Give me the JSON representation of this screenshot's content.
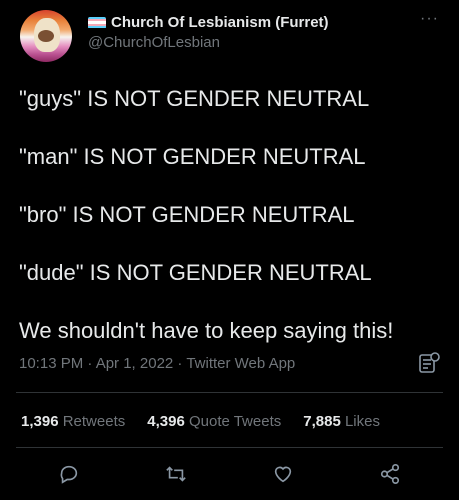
{
  "author": {
    "display_name": "Church Of Lesbianism (Furret)",
    "handle": "@ChurchOfLesbian",
    "flag_colors": [
      "#5bcefa",
      "#f5a9b8",
      "#ffffff",
      "#f5a9b8",
      "#5bcefa"
    ]
  },
  "tweet": {
    "lines": [
      "\"guys\" IS NOT GENDER NEUTRAL",
      "\"man\" IS NOT GENDER NEUTRAL",
      "\"bro\" IS NOT GENDER NEUTRAL",
      "\"dude\" IS NOT GENDER NEUTRAL",
      "We shouldn't have to keep saying this!"
    ],
    "meta": "10:13 PM · Apr 1, 2022 · Twitter Web App"
  },
  "stats": {
    "retweets_count": "1,396",
    "retweets_label": "Retweets",
    "quotes_count": "4,396",
    "quotes_label": "Quote Tweets",
    "likes_count": "7,885",
    "likes_label": "Likes"
  },
  "more_glyph": "···",
  "colors": {
    "background": "#000000",
    "text": "#e7e9ea",
    "secondary": "#71767b",
    "divider": "#2f3336"
  },
  "icons": [
    "more-icon",
    "analytics-icon",
    "reply-icon",
    "retweet-icon",
    "like-icon",
    "share-icon"
  ]
}
